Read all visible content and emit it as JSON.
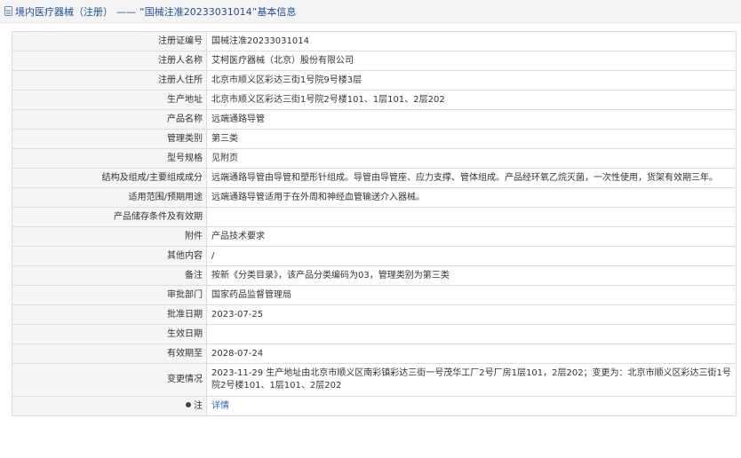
{
  "header": {
    "title": "境内医疗器械（注册）",
    "separator": "——",
    "subtitle": "“国械注准20233031014”",
    "suffix": "基本信息"
  },
  "rows": [
    {
      "label": "注册证编号",
      "value": "国械注准20233031014"
    },
    {
      "label": "注册人名称",
      "value": "艾柯医疗器械（北京）股份有限公司"
    },
    {
      "label": "注册人住所",
      "value": "北京市顺义区彩达三街1号院9号楼3层"
    },
    {
      "label": "生产地址",
      "value": "北京市顺义区彩达三街1号院2号楼101、1层101、2层202"
    },
    {
      "label": "产品名称",
      "value": "远端通路导管"
    },
    {
      "label": "管理类别",
      "value": "第三类"
    },
    {
      "label": "型号规格",
      "value": "见附页"
    },
    {
      "label": "结构及组成/主要组成成分",
      "value": "远端通路导管由导管和塑形针组成。导管由导管座、应力支撑、管体组成。产品经环氧乙烷灭菌，一次性使用，货架有效期三年。"
    },
    {
      "label": "适用范围/预期用途",
      "value": "远端通路导管适用于在外周和神经血管输送介入器械。"
    },
    {
      "label": "产品储存条件及有效期",
      "value": ""
    },
    {
      "label": "附件",
      "value": "产品技术要求"
    },
    {
      "label": "其他内容",
      "value": "/"
    },
    {
      "label": "备注",
      "value": "按新《分类目录》，该产品分类编码为03，管理类别为第三类"
    },
    {
      "label": "审批部门",
      "value": "国家药品监督管理局"
    },
    {
      "label": "批准日期",
      "value": "2023-07-25"
    },
    {
      "label": "生效日期",
      "value": ""
    },
    {
      "label": "有效期至",
      "value": "2028-07-24"
    },
    {
      "label": "变更情况",
      "value": "2023-11-29 生产地址由北京市顺义区南彩镇彩达三街一号茂华工厂2号厂房1层101，2层202；变更为：北京市顺义区彩达三街1号院2号楼101、1层101、2层202"
    }
  ],
  "note": {
    "label": "注",
    "value": "详情"
  }
}
